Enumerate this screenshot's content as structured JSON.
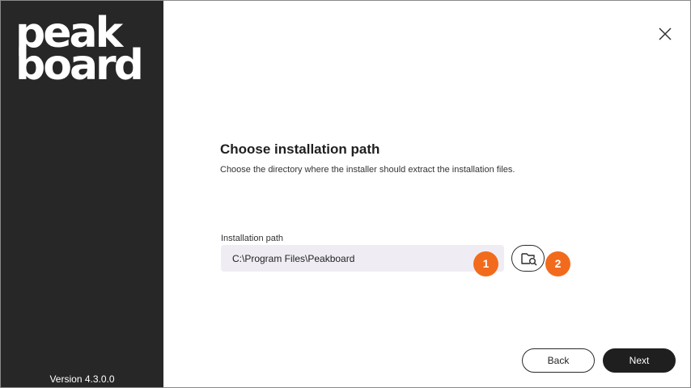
{
  "sidebar": {
    "logo_line1": "peak",
    "logo_line2": "board",
    "version": "Version 4.3.0.0"
  },
  "content": {
    "title": "Choose installation path",
    "description": "Choose the directory where the installer should extract the installation files.",
    "field_label": "Installation path",
    "path_value": "C:\\Program Files\\Peakboard"
  },
  "badges": {
    "one": "1",
    "two": "2"
  },
  "buttons": {
    "back": "Back",
    "next": "Next"
  },
  "icons": {
    "close": "close-icon",
    "browse": "folder-search-icon"
  },
  "colors": {
    "sidebar": "#272727",
    "badge": "#f26b1d",
    "primary_button": "#1f1f1f",
    "input_bg": "#efedf3"
  }
}
